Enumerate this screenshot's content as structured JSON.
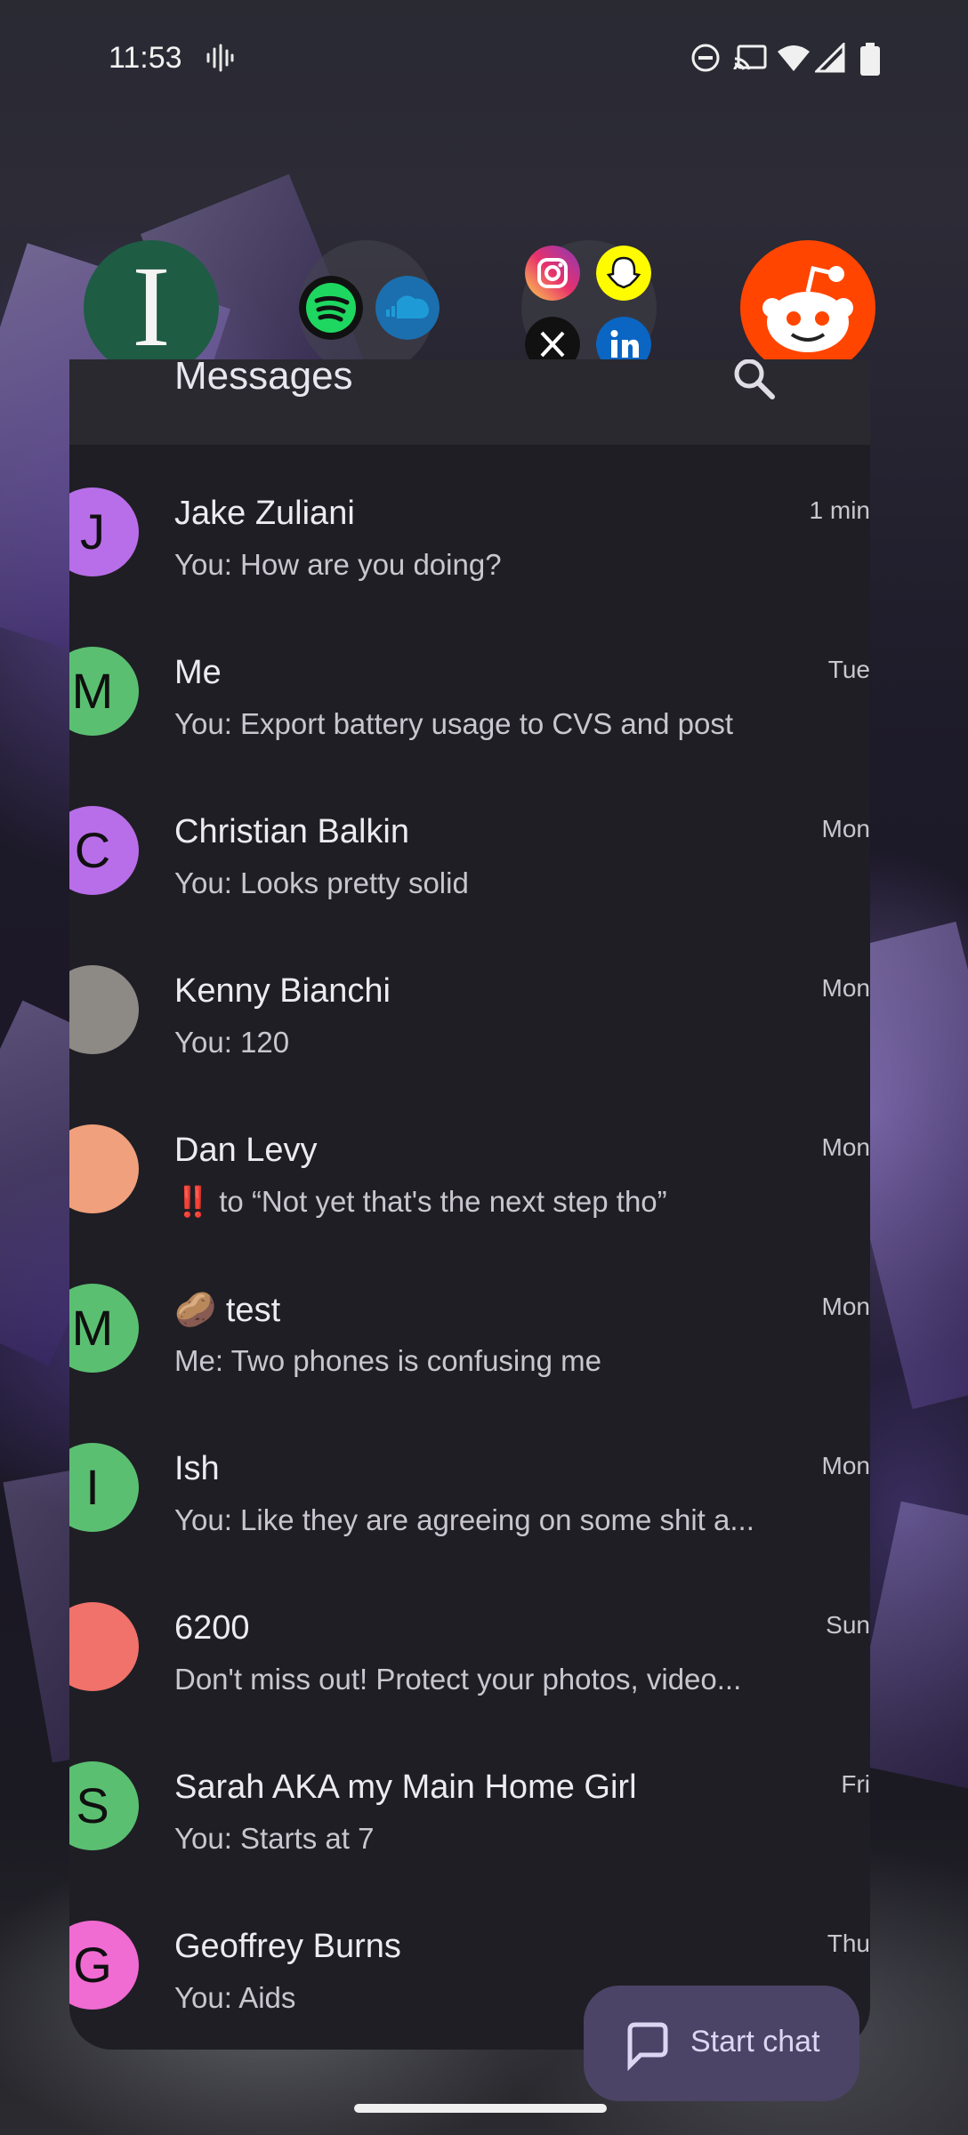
{
  "status_bar": {
    "time": "11:53",
    "icons": [
      "sound-wave-icon",
      "do-not-disturb-icon",
      "cast-icon",
      "wifi-icon",
      "cell-signal-icon",
      "battery-icon"
    ]
  },
  "bubbles": [
    {
      "name": "app-bubble-i",
      "letter": "I",
      "color": "#1e5c44"
    },
    {
      "name": "app-bubble-music",
      "apps": [
        "spotify-icon",
        "soundcloud-icon"
      ]
    },
    {
      "name": "app-bubble-social",
      "apps": [
        "instagram-icon",
        "snapchat-icon",
        "x-icon",
        "linkedin-icon"
      ]
    },
    {
      "name": "app-bubble-reddit",
      "color": "#ff4500"
    }
  ],
  "window": {
    "title": "Messages",
    "conversations": [
      {
        "name": "Jake Zuliani",
        "snippet": "You: How are you doing?",
        "time": "1 min",
        "avatar_letter": "J",
        "avatar_color": "#b86ee8"
      },
      {
        "name": "Me",
        "snippet": "You: Export battery usage to CVS and post",
        "time": "Tue",
        "avatar_letter": "M",
        "avatar_color": "#5bbf72"
      },
      {
        "name": "Christian Balkin",
        "snippet": "You: Looks pretty solid",
        "time": "Mon",
        "avatar_letter": "C",
        "avatar_color": "#b86ee8"
      },
      {
        "name": "Kenny Bianchi",
        "snippet": "You: 120",
        "time": "Mon",
        "avatar_letter": "",
        "avatar_color": "#8d8a86"
      },
      {
        "name": "Dan Levy",
        "snippet": "‼️ to “Not yet that's the next step tho”",
        "time": "Mon",
        "avatar_letter": "",
        "avatar_color": "#f0a07c"
      },
      {
        "name": "🥔 test",
        "snippet": "Me: Two phones is confusing me",
        "time": "Mon",
        "avatar_letter": "M",
        "avatar_color": "#5bbf72"
      },
      {
        "name": "Ish",
        "snippet": "You: Like they are agreeing on some shit a...",
        "time": "Mon",
        "avatar_letter": "I",
        "avatar_color": "#5bbf72"
      },
      {
        "name": "6200",
        "snippet": "Don't miss out! Protect your photos, video...",
        "time": "Sun",
        "avatar_letter": "",
        "avatar_color": "#f0726a"
      },
      {
        "name": "Sarah AKA my Main Home Girl",
        "snippet": "You: Starts at 7",
        "time": "Fri",
        "avatar_letter": "S",
        "avatar_color": "#5bbf72"
      },
      {
        "name": "Geoffrey Burns",
        "snippet": "You: Aids",
        "time": "Thu",
        "avatar_letter": "G",
        "avatar_color": "#f06bd2"
      }
    ]
  },
  "fab": {
    "label": "Start chat"
  }
}
